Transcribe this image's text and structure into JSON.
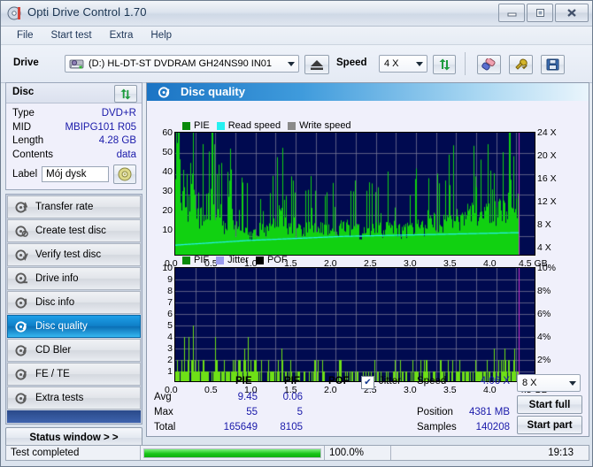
{
  "window": {
    "title": "Opti Drive Control 1.70",
    "icon": "disc-icon",
    "buttons": {
      "minimize": "–",
      "maximize": "□",
      "close": "✕"
    }
  },
  "menu": {
    "items": [
      "File",
      "Start test",
      "Extra",
      "Help"
    ]
  },
  "toolbar": {
    "drive_label": "Drive",
    "drive_value": "(D:)   HL-DT-ST DVDRAM GH24NS90 IN01",
    "drive_icon": "drive-icon",
    "eject_icon": "eject-icon",
    "speed_label": "Speed",
    "speed_value": "4 X",
    "refresh_icon": "refresh-icon",
    "eraser_icon": "eraser-icon",
    "tools_icon": "tools-icon",
    "save_icon": "save-icon"
  },
  "disc": {
    "header": "Disc",
    "refresh_icon": "refresh-icon",
    "rows": [
      {
        "key": "Type",
        "value": "DVD+R"
      },
      {
        "key": "MID",
        "value": "MBIPG101 R05"
      },
      {
        "key": "Length",
        "value": "4.28 GB"
      },
      {
        "key": "Contents",
        "value": "data"
      }
    ],
    "label_key": "Label",
    "label_value": "Mój dysk",
    "label_icon": "cd-icon"
  },
  "nav": {
    "items": [
      {
        "label": "Transfer rate",
        "icon": "transfer-rate-icon",
        "active": false
      },
      {
        "label": "Create test disc",
        "icon": "create-test-disc-icon",
        "active": false
      },
      {
        "label": "Verify test disc",
        "icon": "verify-test-disc-icon",
        "active": false
      },
      {
        "label": "Drive info",
        "icon": "drive-info-icon",
        "active": false
      },
      {
        "label": "Disc info",
        "icon": "disc-info-icon",
        "active": false
      },
      {
        "label": "Disc quality",
        "icon": "disc-quality-icon",
        "active": true
      },
      {
        "label": "CD Bler",
        "icon": "cd-bler-icon",
        "active": false
      },
      {
        "label": "FE / TE",
        "icon": "fe-te-icon",
        "active": false
      },
      {
        "label": "Extra tests",
        "icon": "extra-tests-icon",
        "active": false
      }
    ],
    "status_button": "Status window > >"
  },
  "panel": {
    "title": "Disc quality",
    "icon": "disc-quality-icon"
  },
  "stats": {
    "col_headers": [
      "PIE",
      "PIF",
      "POF"
    ],
    "jitter_label": "Jitter",
    "jitter_checked": true,
    "rows": [
      {
        "name": "Avg",
        "pie": "9.45",
        "pif": "0.06",
        "pof": ""
      },
      {
        "name": "Max",
        "pie": "55",
        "pif": "5",
        "pof": ""
      },
      {
        "name": "Total",
        "pie": "165649",
        "pif": "8105",
        "pof": ""
      }
    ],
    "speed_label": "Speed",
    "speed_value": "4.06 X",
    "position_label": "Position",
    "position_value": "4381 MB",
    "samples_label": "Samples",
    "samples_value": "140208",
    "test_speed_select": "8 X",
    "start_full": "Start full",
    "start_part": "Start part"
  },
  "statusbar": {
    "message": "Test completed",
    "percent": "100.0%",
    "percent_value": 100,
    "time": "19:13"
  },
  "colors": {
    "plot_bg": "#000a50",
    "pie_green": "#11d111",
    "read_speed_cyan": "#25f0f0",
    "write_speed_gray": "#8a8a8a",
    "jitter_lilac": "#9a9aee",
    "pof_black": "#000000",
    "cursor_magenta": "#cc33cc",
    "value_blue": "#1a1aaa",
    "accent_blue": "#1b74c4"
  },
  "chart_data": [
    {
      "type": "area",
      "name": "pie-chart",
      "title": "",
      "legend": [
        {
          "label": "PIE",
          "color": "#0a8a0a"
        },
        {
          "label": "Read speed",
          "color": "#25f0f0"
        },
        {
          "label": "Write speed",
          "color": "#8a8a8a"
        }
      ],
      "legend_position": "top-left",
      "grid": true,
      "xlabel": "GB",
      "xlim": [
        0.0,
        4.5
      ],
      "xticks": [
        "0.0",
        "0.5",
        "1.0",
        "1.5",
        "2.0",
        "2.5",
        "3.0",
        "3.5",
        "4.0",
        "4.5 GB"
      ],
      "ylabel": "PIE",
      "ylim": [
        0,
        60
      ],
      "yticks": [
        "10",
        "20",
        "30",
        "40",
        "50",
        "60"
      ],
      "y2label": "Speed",
      "y2lim": [
        0,
        24
      ],
      "y2ticks": [
        "4 X",
        "8 X",
        "12 X",
        "16 X",
        "20 X",
        "24 X"
      ],
      "data_end_x": 4.28,
      "cursor_x": 4.28,
      "series": [
        {
          "name": "PIE",
          "color": "#11d111",
          "kind": "area",
          "x": [
            0.0,
            0.04,
            0.08,
            0.12,
            0.16,
            0.2,
            0.24,
            0.28,
            0.32,
            0.36,
            0.4,
            0.45,
            0.5,
            0.55,
            0.6,
            0.65,
            0.7,
            0.75,
            0.8,
            0.85,
            0.9,
            0.95,
            1.0,
            1.1,
            1.2,
            1.3,
            1.4,
            1.5,
            1.6,
            1.7,
            1.8,
            1.9,
            2.0,
            2.1,
            2.2,
            2.3,
            2.4,
            2.5,
            2.6,
            2.7,
            2.8,
            2.9,
            3.0,
            3.1,
            3.2,
            3.3,
            3.4,
            3.5,
            3.6,
            3.7,
            3.8,
            3.9,
            4.0,
            4.1,
            4.2,
            4.28
          ],
          "values": [
            36,
            55,
            30,
            41,
            27,
            42,
            31,
            23,
            26,
            24,
            19,
            40,
            27,
            22,
            20,
            18,
            25,
            17,
            16,
            19,
            14,
            13,
            17,
            15,
            18,
            25,
            16,
            15,
            17,
            16,
            19,
            17,
            15,
            18,
            16,
            15,
            14,
            17,
            16,
            19,
            15,
            16,
            18,
            17,
            21,
            19,
            23,
            22,
            24,
            25,
            23,
            27,
            26,
            29,
            31,
            30
          ],
          "peaks_note": "dense per-sample spikes; max 55 near 0.05 GB, baseline ~10-20 falling to ~9 mid-disc then rising to ~30 at end"
        },
        {
          "name": "Read speed",
          "color": "#25f0f0",
          "kind": "line",
          "x": [
            0.0,
            0.3,
            0.6,
            0.9,
            1.2,
            1.5,
            1.8,
            2.1,
            2.4,
            2.7,
            3.0,
            3.3,
            3.6,
            3.9,
            4.2,
            4.28
          ],
          "values": [
            2.2,
            2.5,
            2.8,
            3.1,
            3.3,
            3.5,
            3.7,
            3.9,
            4.0,
            4.1,
            4.2,
            4.3,
            4.4,
            4.5,
            4.6,
            4.6
          ],
          "axis": "y2"
        },
        {
          "name": "Write speed",
          "color": "#8a8a8a",
          "kind": "line",
          "x": [],
          "values": [],
          "axis": "y2"
        }
      ]
    },
    {
      "type": "area",
      "name": "pif-chart",
      "title": "",
      "legend": [
        {
          "label": "PIF",
          "color": "#0a8a0a"
        },
        {
          "label": "Jitter",
          "color": "#9a9aee"
        },
        {
          "label": "POF",
          "color": "#000000"
        }
      ],
      "legend_position": "top-left",
      "grid": true,
      "xlabel": "GB",
      "xlim": [
        0.0,
        4.5
      ],
      "xticks": [
        "0.0",
        "0.5",
        "1.0",
        "1.5",
        "2.0",
        "2.5",
        "3.0",
        "3.5",
        "4.0",
        "4.5 GB"
      ],
      "ylabel": "PIF",
      "ylim": [
        0,
        10
      ],
      "yticks": [
        "1",
        "2",
        "3",
        "4",
        "5",
        "6",
        "7",
        "8",
        "9",
        "10"
      ],
      "y2label": "Jitter",
      "y2lim": [
        0,
        10
      ],
      "y2ticks": [
        "2%",
        "4%",
        "6%",
        "8%",
        "10%"
      ],
      "data_end_x": 4.28,
      "cursor_x": 4.28,
      "series": [
        {
          "name": "PIF",
          "color": "#6ee016",
          "kind": "area",
          "x": [
            0.05,
            0.1,
            0.15,
            0.2,
            0.25,
            0.3,
            0.35,
            0.4,
            0.45,
            0.5,
            0.55,
            0.6,
            0.65,
            0.7,
            0.75,
            0.8,
            0.85,
            0.9,
            0.95,
            1.0,
            1.2,
            1.4,
            1.6,
            1.8,
            2.0,
            2.1,
            2.2,
            2.4,
            2.6,
            2.8,
            2.9,
            3.0,
            3.2,
            3.4,
            3.6,
            3.8,
            4.0,
            4.1,
            4.2,
            4.28
          ],
          "values": [
            4,
            2,
            3,
            5,
            3,
            2,
            1,
            2,
            1,
            4,
            2,
            1,
            3,
            3,
            1,
            2,
            3,
            4,
            2,
            1,
            1,
            1,
            1,
            1,
            2,
            2,
            2,
            1,
            1,
            2,
            1,
            1,
            1,
            2,
            2,
            1,
            2,
            3,
            3,
            2
          ],
          "peaks_note": "sparse spikes of 1-2 with occasional 3-5; max 5 near 0.2 GB"
        },
        {
          "name": "Jitter",
          "color": "#9a9aee",
          "kind": "line",
          "x": [],
          "values": [],
          "axis": "y2"
        },
        {
          "name": "POF",
          "color": "#000000",
          "kind": "bar",
          "x": [],
          "values": []
        }
      ]
    }
  ]
}
